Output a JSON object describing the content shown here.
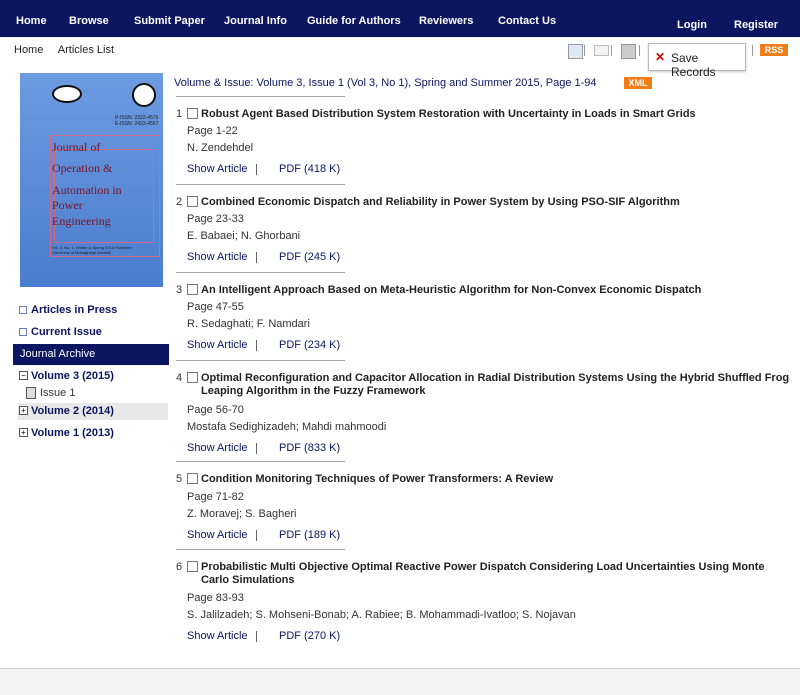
{
  "nav": {
    "items": [
      "Home",
      "Browse",
      "Submit Paper",
      "Journal Info",
      "Guide for Authors",
      "Reviewers",
      "Contact Us"
    ],
    "login": "Login",
    "register": "Register"
  },
  "breadcrumb": [
    "Home",
    "Articles List"
  ],
  "toolbar": {
    "save_label": "Save Records",
    "rss_label": "RSS"
  },
  "cover": {
    "issn": "P-ISSN: 2322-4576\nE-ISSN: 2423-4567",
    "title_lines": [
      "Journal of",
      "Operation &",
      "Automation in",
      "Power",
      "Engineering"
    ],
    "vol_text": "Vol. 3, No. 1, Winter & Spring 2015 Publisher University of Mohaghegh Ardabili"
  },
  "sidebar": {
    "links": [
      "Articles in Press",
      "Current Issue"
    ],
    "archive_title": "Journal Archive",
    "volumes": [
      "Volume 3 (2015)",
      "Volume 2 (2014)",
      "Volume 1 (2013)"
    ],
    "issue": "Issue 1"
  },
  "main": {
    "volume_heading": "Volume & Issue: Volume 3, Issue 1 (Vol 3, No 1), Spring and Summer 2015, Page 1-94",
    "xml_label": "XML",
    "show_article_label": "Show Article",
    "articles": [
      {
        "num": "1",
        "title": "Robust Agent Based Distribution System Restoration with Uncertainty in Loads in Smart Grids",
        "pages": "Page 1-22",
        "authors": "N. Zendehdel",
        "pdf": "PDF (418 K)"
      },
      {
        "num": "2",
        "title": "Combined Economic Dispatch and Reliability in Power System by Using PSO-SIF Algorithm",
        "pages": "Page 23-33",
        "authors": "E. Babaei; N. Ghorbani",
        "pdf": "PDF (245 K)"
      },
      {
        "num": "3",
        "title": "An Intelligent Approach Based on Meta-Heuristic Algorithm for Non-Convex Economic Dispatch",
        "pages": "Page 47-55",
        "authors": "R. Sedaghati; F. Namdari",
        "pdf": "PDF (234 K)"
      },
      {
        "num": "4",
        "title": "Optimal Reconfiguration and Capacitor Allocation in Radial Distribution Systems Using the Hybrid Shuffled Frog Leaping Algorithm in the Fuzzy Framework",
        "pages": "Page 56-70",
        "authors": "Mostafa Sedighizadeh; Mahdi mahmoodi",
        "pdf": "PDF (833 K)"
      },
      {
        "num": "5",
        "title": "Condition Monitoring Techniques of Power Transformers: A Review",
        "pages": "Page 71-82",
        "authors": "Z. Moravej; S. Bagheri",
        "pdf": "PDF (189 K)"
      },
      {
        "num": "6",
        "title": "Probabilistic Multi Objective Optimal Reactive Power Dispatch Considering Load Uncertainties Using Monte Carlo Simulations",
        "pages": "Page 83-93",
        "authors": "S. Jalilzadeh; S. Mohseni-Bonab; A. Rabiee; B. Mohammadi-Ivatloo; S. Nojavan",
        "pdf": "PDF (270 K)"
      }
    ]
  },
  "colors": {
    "nav": "#0b1560",
    "accent": "#f07d16"
  }
}
